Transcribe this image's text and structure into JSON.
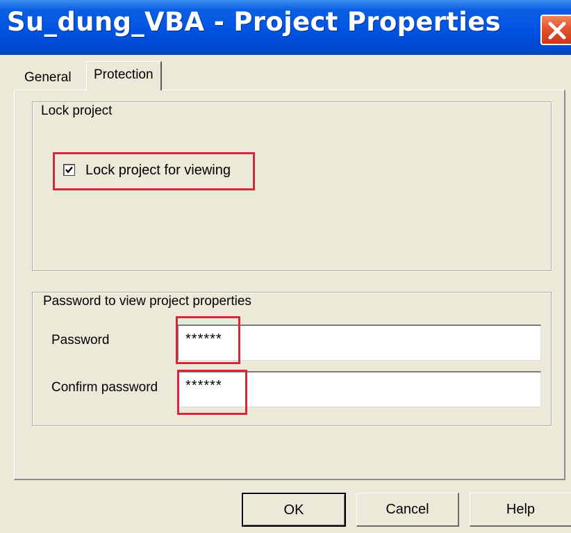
{
  "window": {
    "title": "Su_dung_VBA - Project Properties"
  },
  "tabs": [
    {
      "label": "General",
      "selected": false
    },
    {
      "label": "Protection",
      "selected": true
    }
  ],
  "lock_group": {
    "legend": "Lock project",
    "checkbox_label": "Lock project for viewing",
    "checked": true
  },
  "password_group": {
    "legend": "Password to view project properties",
    "password_label": "Password",
    "password_value": "******",
    "confirm_label": "Confirm password",
    "confirm_value": "******"
  },
  "buttons": {
    "ok": "OK",
    "cancel": "Cancel",
    "help": "Help"
  },
  "icons": {
    "close": "close-icon",
    "check": "checkmark-icon"
  },
  "colors": {
    "titlebar": "#0054e3",
    "highlight": "#d3293a",
    "dialog_bg": "#ece9d8"
  }
}
